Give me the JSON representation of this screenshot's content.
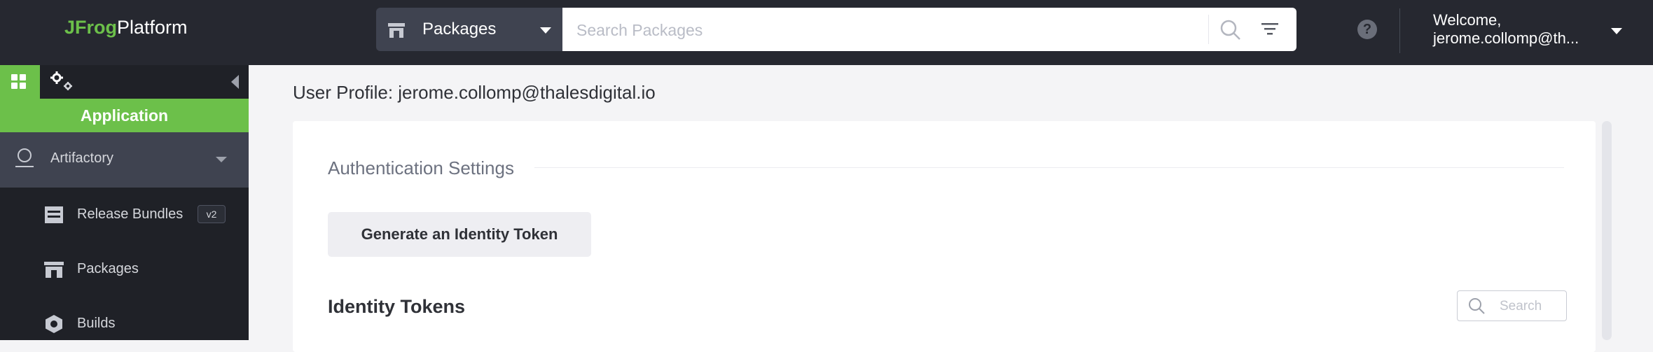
{
  "header": {
    "logo_brand": "JFrog",
    "logo_product": "Platform",
    "package_select_label": "Packages",
    "search_placeholder": "Search Packages",
    "help_symbol": "?",
    "welcome_line1": "Welcome,",
    "welcome_line2": "jerome.collomp@th..."
  },
  "sidebar": {
    "section_label": "Application",
    "group": {
      "label": "Artifactory",
      "icon": "artifactory-icon"
    },
    "items": [
      {
        "label": "Release Bundles",
        "badge": "v2",
        "icon": "release-bundles-icon"
      },
      {
        "label": "Packages",
        "icon": "packages-icon"
      },
      {
        "label": "Builds",
        "icon": "builds-icon"
      }
    ]
  },
  "main": {
    "page_title": "User Profile: jerome.collomp@thalesdigital.io",
    "auth_section_title": "Authentication Settings",
    "generate_button_label": "Generate an Identity Token",
    "identity_tokens_title": "Identity Tokens",
    "tokens_search_placeholder": "Search"
  },
  "colors": {
    "accent_green": "#6cc04a",
    "topbar_bg": "#262830",
    "sidebar_bg": "#1f2127",
    "selected_bg": "#3f4350"
  }
}
